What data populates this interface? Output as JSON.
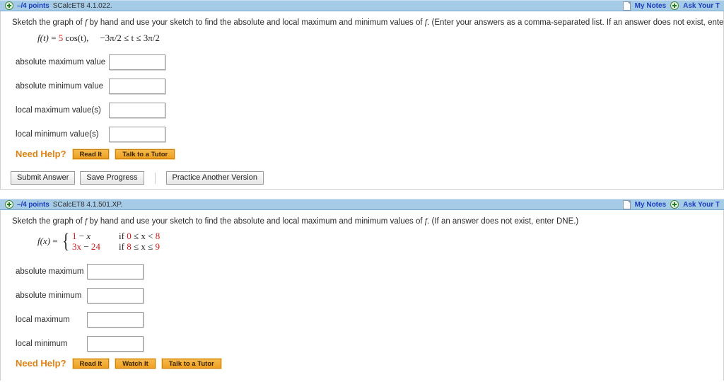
{
  "problems": [
    {
      "header": {
        "plus_icon": "plus-circle-icon",
        "points": "–/4 points",
        "code": "SCalcET8 4.1.022.",
        "notes_icon": "note-page-icon",
        "notes_label": "My Notes",
        "ask_icon": "plus-circle-icon",
        "ask_label": "Ask Your T"
      },
      "question": "Sketch the graph of f by hand and use your sketch to find the absolute and local maximum and minimum values of f. (Enter your answers as a comma-separated list. If an answer does not exist, enter DNE.)",
      "question_parts": {
        "pre": "Sketch the graph of ",
        "var1": "f",
        "mid": " by hand and use your sketch to find the absolute and local maximum and minimum values of ",
        "var2": "f",
        "post": ". (Enter your answers as a comma-separated list. If an answer does not exist, enter DNE.)"
      },
      "formula": {
        "type": "simple",
        "lhs": "f(t)",
        "eq": "=",
        "coefficient": "5",
        "rest": "cos(t),",
        "domain": "−3π/2 ≤ t ≤ 3π/2"
      },
      "answers": [
        {
          "label": "absolute maximum value",
          "value": "",
          "name": "absolute-maximum-value-input"
        },
        {
          "label": "absolute minimum value",
          "value": "",
          "name": "absolute-minimum-value-input"
        },
        {
          "label": "local maximum value(s)",
          "value": "",
          "name": "local-maximum-values-input"
        },
        {
          "label": "local minimum value(s)",
          "value": "",
          "name": "local-minimum-values-input"
        }
      ],
      "label_width": 132,
      "help": {
        "title": "Need Help?",
        "buttons": [
          "Read It",
          "Talk to a Tutor"
        ]
      },
      "footer": {
        "submit": "Submit Answer",
        "save": "Save Progress",
        "practice": "Practice Another Version"
      }
    },
    {
      "header": {
        "plus_icon": "plus-circle-icon",
        "points": "–/4 points",
        "code": "SCalcET8 4.1.501.XP.",
        "notes_icon": "note-page-icon",
        "notes_label": "My Notes",
        "ask_icon": "plus-circle-icon",
        "ask_label": "Ask Your T"
      },
      "question": "Sketch the graph of f by hand and use your sketch to find the absolute and local maximum and minimum values of f. (If an answer does not exist, enter DNE.)",
      "question_parts": {
        "pre": "Sketch the graph of ",
        "var1": "f",
        "mid": " by hand and use your sketch to find the absolute and local maximum and minimum values of ",
        "var2": "f",
        "post": ". (If an answer does not exist, enter DNE.)"
      },
      "formula": {
        "type": "piecewise",
        "lhs": "f(x)",
        "eq": "=",
        "cases": [
          {
            "expr_a": "1",
            "expr_b": "−",
            "expr_c": "x",
            "cond_if": "if",
            "cond_lo": "0",
            "cond_rel1": "≤ x <",
            "cond_hi": "8"
          },
          {
            "expr_a": "3x",
            "expr_b": "−",
            "expr_c": "24",
            "cond_if": "if",
            "cond_lo": "8",
            "cond_rel1": "≤ x ≤",
            "cond_hi": "9"
          }
        ]
      },
      "answers": [
        {
          "label": "absolute maximum",
          "value": "",
          "name": "absolute-maximum-input"
        },
        {
          "label": "absolute minimum",
          "value": "",
          "name": "absolute-minimum-input"
        },
        {
          "label": "local maximum",
          "value": "",
          "name": "local-maximum-input"
        },
        {
          "label": "local minimum",
          "value": "",
          "name": "local-minimum-input"
        }
      ],
      "label_width": 101,
      "help": {
        "title": "Need Help?",
        "buttons": [
          "Read It",
          "Watch It",
          "Talk to a Tutor"
        ]
      }
    }
  ],
  "colors": {
    "header_bar": "#a6cbe7",
    "link_blue": "#1b3fbf",
    "accent_orange": "#e08214",
    "math_red": "#d11a1a"
  }
}
